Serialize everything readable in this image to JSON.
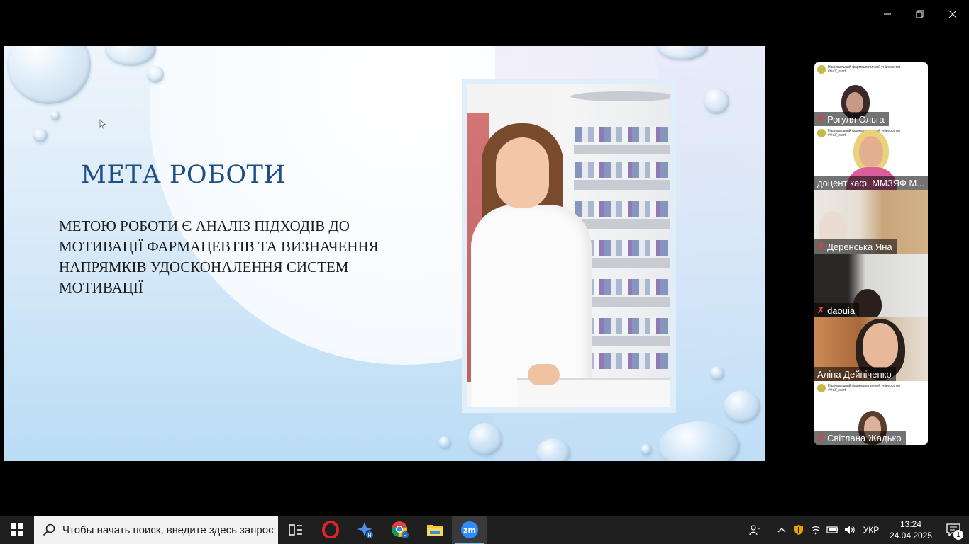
{
  "window": {
    "controls": [
      "minimize",
      "restore",
      "close"
    ]
  },
  "slide": {
    "title": "МЕТА РОБОТИ",
    "body": "МЕТОЮ РОБОТИ Є АНАЛІЗ ПІДХОДІВ ДО МОТИВАЦІЇ ФАРМАЦЕВТІВ ТА ВИЗНАЧЕННЯ НАПРЯМКІВ УДОСКОНАЛЕННЯ СИСТЕМ МОТИВАЦІЇ"
  },
  "participants": [
    {
      "name": "Рогуля Ольга",
      "muted": true,
      "org": "Національний фармацевтичний університет",
      "tag": "#ФаУ_start"
    },
    {
      "name": "доцент каф. ММЗЯФ М...",
      "muted": false,
      "org": "Національний фармацевтичний університет",
      "tag": "#ФаУ_start"
    },
    {
      "name": "Деренська Яна",
      "muted": true
    },
    {
      "name": "daouia",
      "muted": true
    },
    {
      "name": "Аліна Дейніченко",
      "muted": false,
      "active": true
    },
    {
      "name": "Світлана Жадько",
      "muted": true,
      "org": "Національний фармацевтичний університет",
      "tag": "#ФаУ_start"
    }
  ],
  "taskbar": {
    "search_placeholder": "Чтобы начать поиск, введите здесь запрос",
    "apps": [
      "task-view",
      "opera",
      "copilot",
      "chrome",
      "file-explorer",
      "zoom"
    ],
    "language": "УКР",
    "time": "13:24",
    "date": "24.04.2025",
    "notifications": "1"
  }
}
